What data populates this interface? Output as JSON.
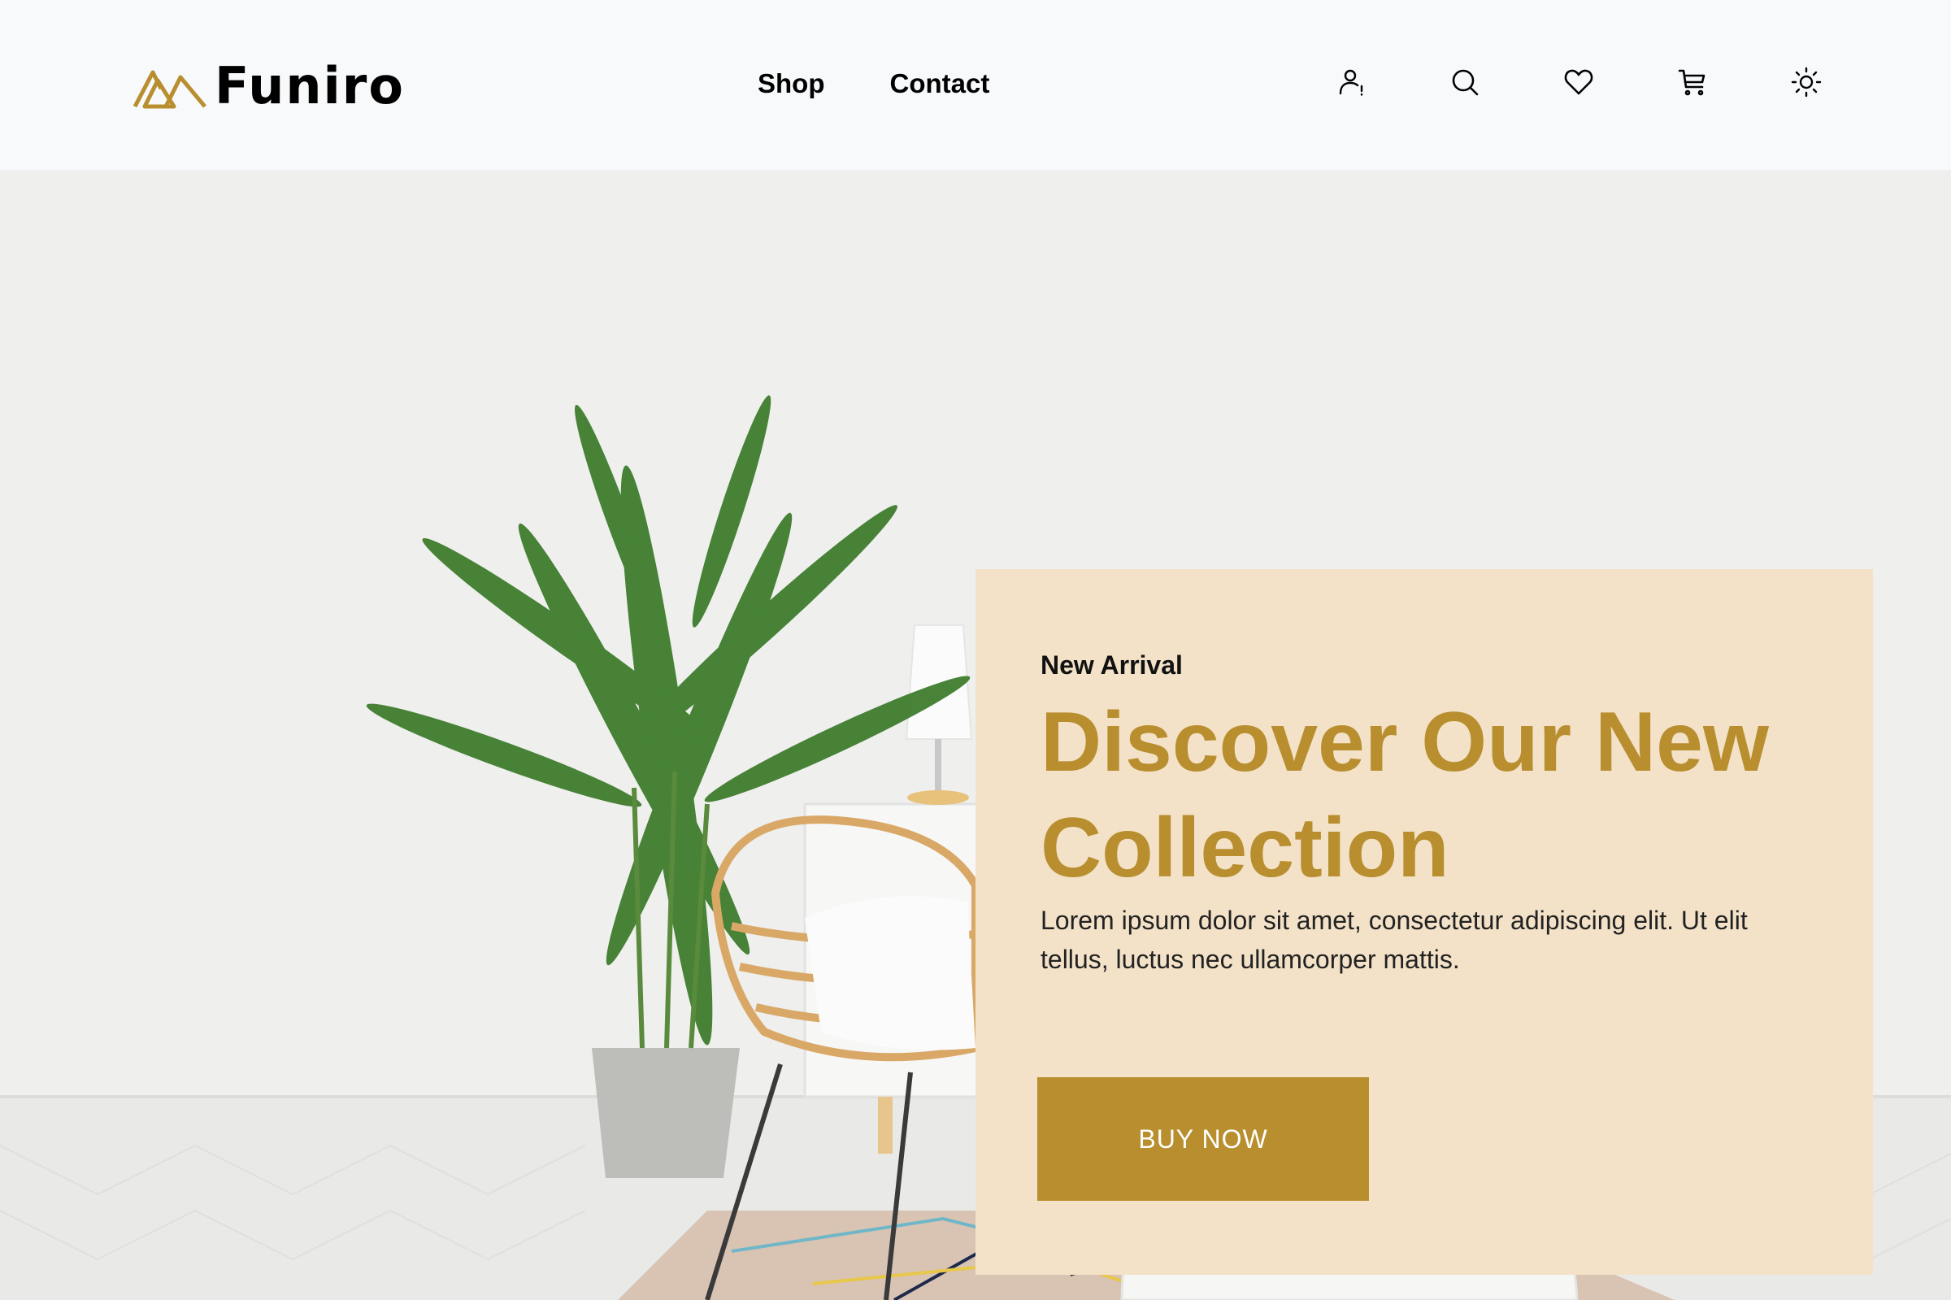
{
  "brand": {
    "name": "Funiro",
    "accent": "#b88e2f"
  },
  "nav": {
    "items": [
      {
        "label": "Shop"
      },
      {
        "label": "Contact"
      }
    ]
  },
  "header_icons": [
    "account-alert-icon",
    "search-icon",
    "heart-icon",
    "cart-icon",
    "sun-icon"
  ],
  "hero": {
    "eyebrow": "New Arrival",
    "title": "Discover Our New Collection",
    "description": "Lorem ipsum dolor sit amet, consectetur adipiscing elit. Ut elit tellus, luctus nec ullamcorper mattis.",
    "cta_label": "BUY NOW",
    "card_color": "#f3e2c8"
  }
}
